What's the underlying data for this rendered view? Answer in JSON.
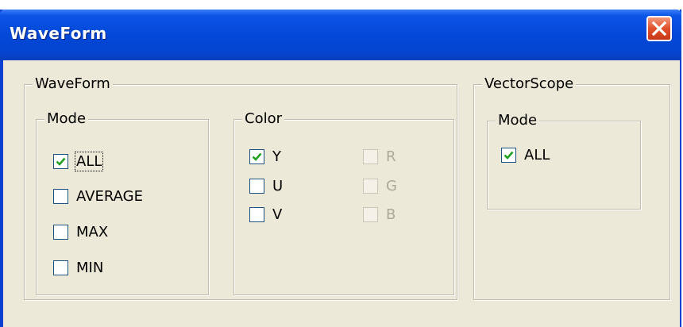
{
  "window": {
    "title": "WaveForm",
    "colors": {
      "titlebar": "#0448d8",
      "background": "#ece9d8",
      "close": "#e0502a"
    }
  },
  "icons": {
    "close": "close-x-icon",
    "check": "check-mark-icon"
  },
  "waveform_group": {
    "legend": "WaveForm",
    "mode": {
      "legend": "Mode",
      "options": [
        {
          "label": "ALL",
          "checked": true
        },
        {
          "label": "AVERAGE",
          "checked": false
        },
        {
          "label": "MAX",
          "checked": false
        },
        {
          "label": "MIN",
          "checked": false
        }
      ]
    },
    "color": {
      "legend": "Color",
      "options": [
        {
          "label": "Y",
          "checked": true,
          "enabled": true
        },
        {
          "label": "U",
          "checked": false,
          "enabled": true
        },
        {
          "label": "V",
          "checked": false,
          "enabled": true
        },
        {
          "label": "R",
          "checked": false,
          "enabled": false
        },
        {
          "label": "G",
          "checked": false,
          "enabled": false
        },
        {
          "label": "B",
          "checked": false,
          "enabled": false
        }
      ]
    }
  },
  "vectorscope_group": {
    "legend": "VectorScope",
    "mode": {
      "legend": "Mode",
      "options": [
        {
          "label": "ALL",
          "checked": true
        }
      ]
    }
  }
}
